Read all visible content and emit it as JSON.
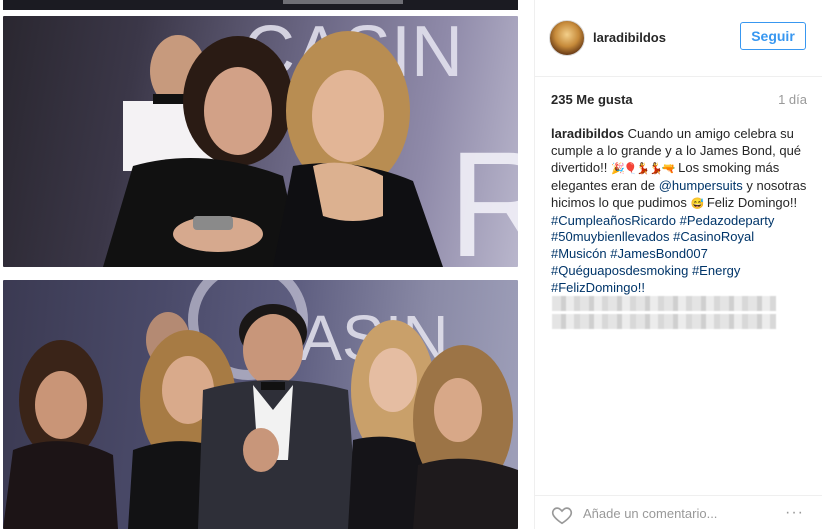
{
  "post": {
    "photo_top_alt": "Dos mujeres en una fiesta estilo Casino",
    "photo_bottom_alt": "Grupo en una fiesta estilo James Bond",
    "top_photo_text": "CASIN",
    "bottom_photo_text": "CASIN"
  },
  "header": {
    "username": "laradibildos",
    "follow_label": "Seguir"
  },
  "stats": {
    "likes": "235 Me gusta",
    "time": "1 día"
  },
  "caption": {
    "username": "laradibildos",
    "text1": "Cuando un amigo celebra su cumple a lo grande y a lo James Bond, qué divertido!!",
    "emojis": "🎉🎈💃💃🔫",
    "text2": "Los smoking más elegantes eran de",
    "mention": "@humpersuits",
    "text3": "y nosotras hicimos lo que pudimos",
    "emoji2": "😅",
    "text4": "Feliz Domingo!!",
    "hashtags": [
      "#CumpleañosRicardo",
      "#Pedazodeparty",
      "#50muybienllevados",
      "#CasinoRoyal",
      "#Musicón",
      "#JamesBond007",
      "#Quéguaposdesmoking",
      "#Energy",
      "#FelizDomingo!!"
    ]
  },
  "comment": {
    "placeholder": "Añade un comentario...",
    "more": "···"
  }
}
